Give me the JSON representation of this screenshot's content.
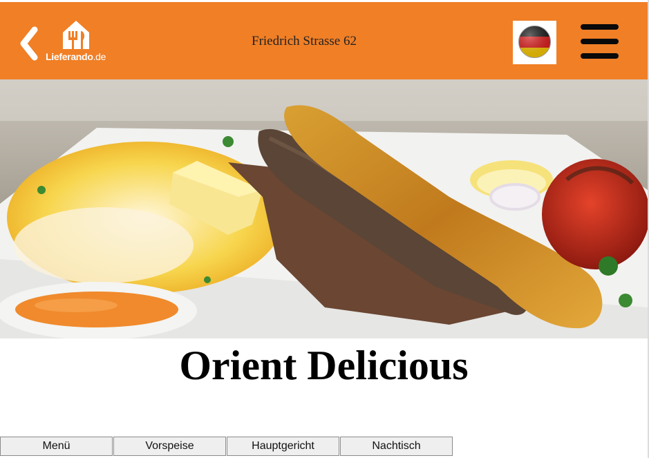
{
  "header": {
    "back_icon": "chevron-left-icon",
    "logo_icon": "house-fork-knife-icon",
    "logo_text": "Lieferando",
    "logo_domain": ".de",
    "address": "Friedrich Strasse 62",
    "language_flag": "germany-flag-icon",
    "menu_icon": "hamburger-menu-icon",
    "background_color": "#f07f26"
  },
  "hero": {
    "image": "kebab-plate-with-rice-photo"
  },
  "restaurant": {
    "name": "Orient Delicious"
  },
  "tabs": [
    {
      "label": "Menü"
    },
    {
      "label": "Vorspeise"
    },
    {
      "label": "Hauptgericht"
    },
    {
      "label": "Nachtisch"
    }
  ]
}
